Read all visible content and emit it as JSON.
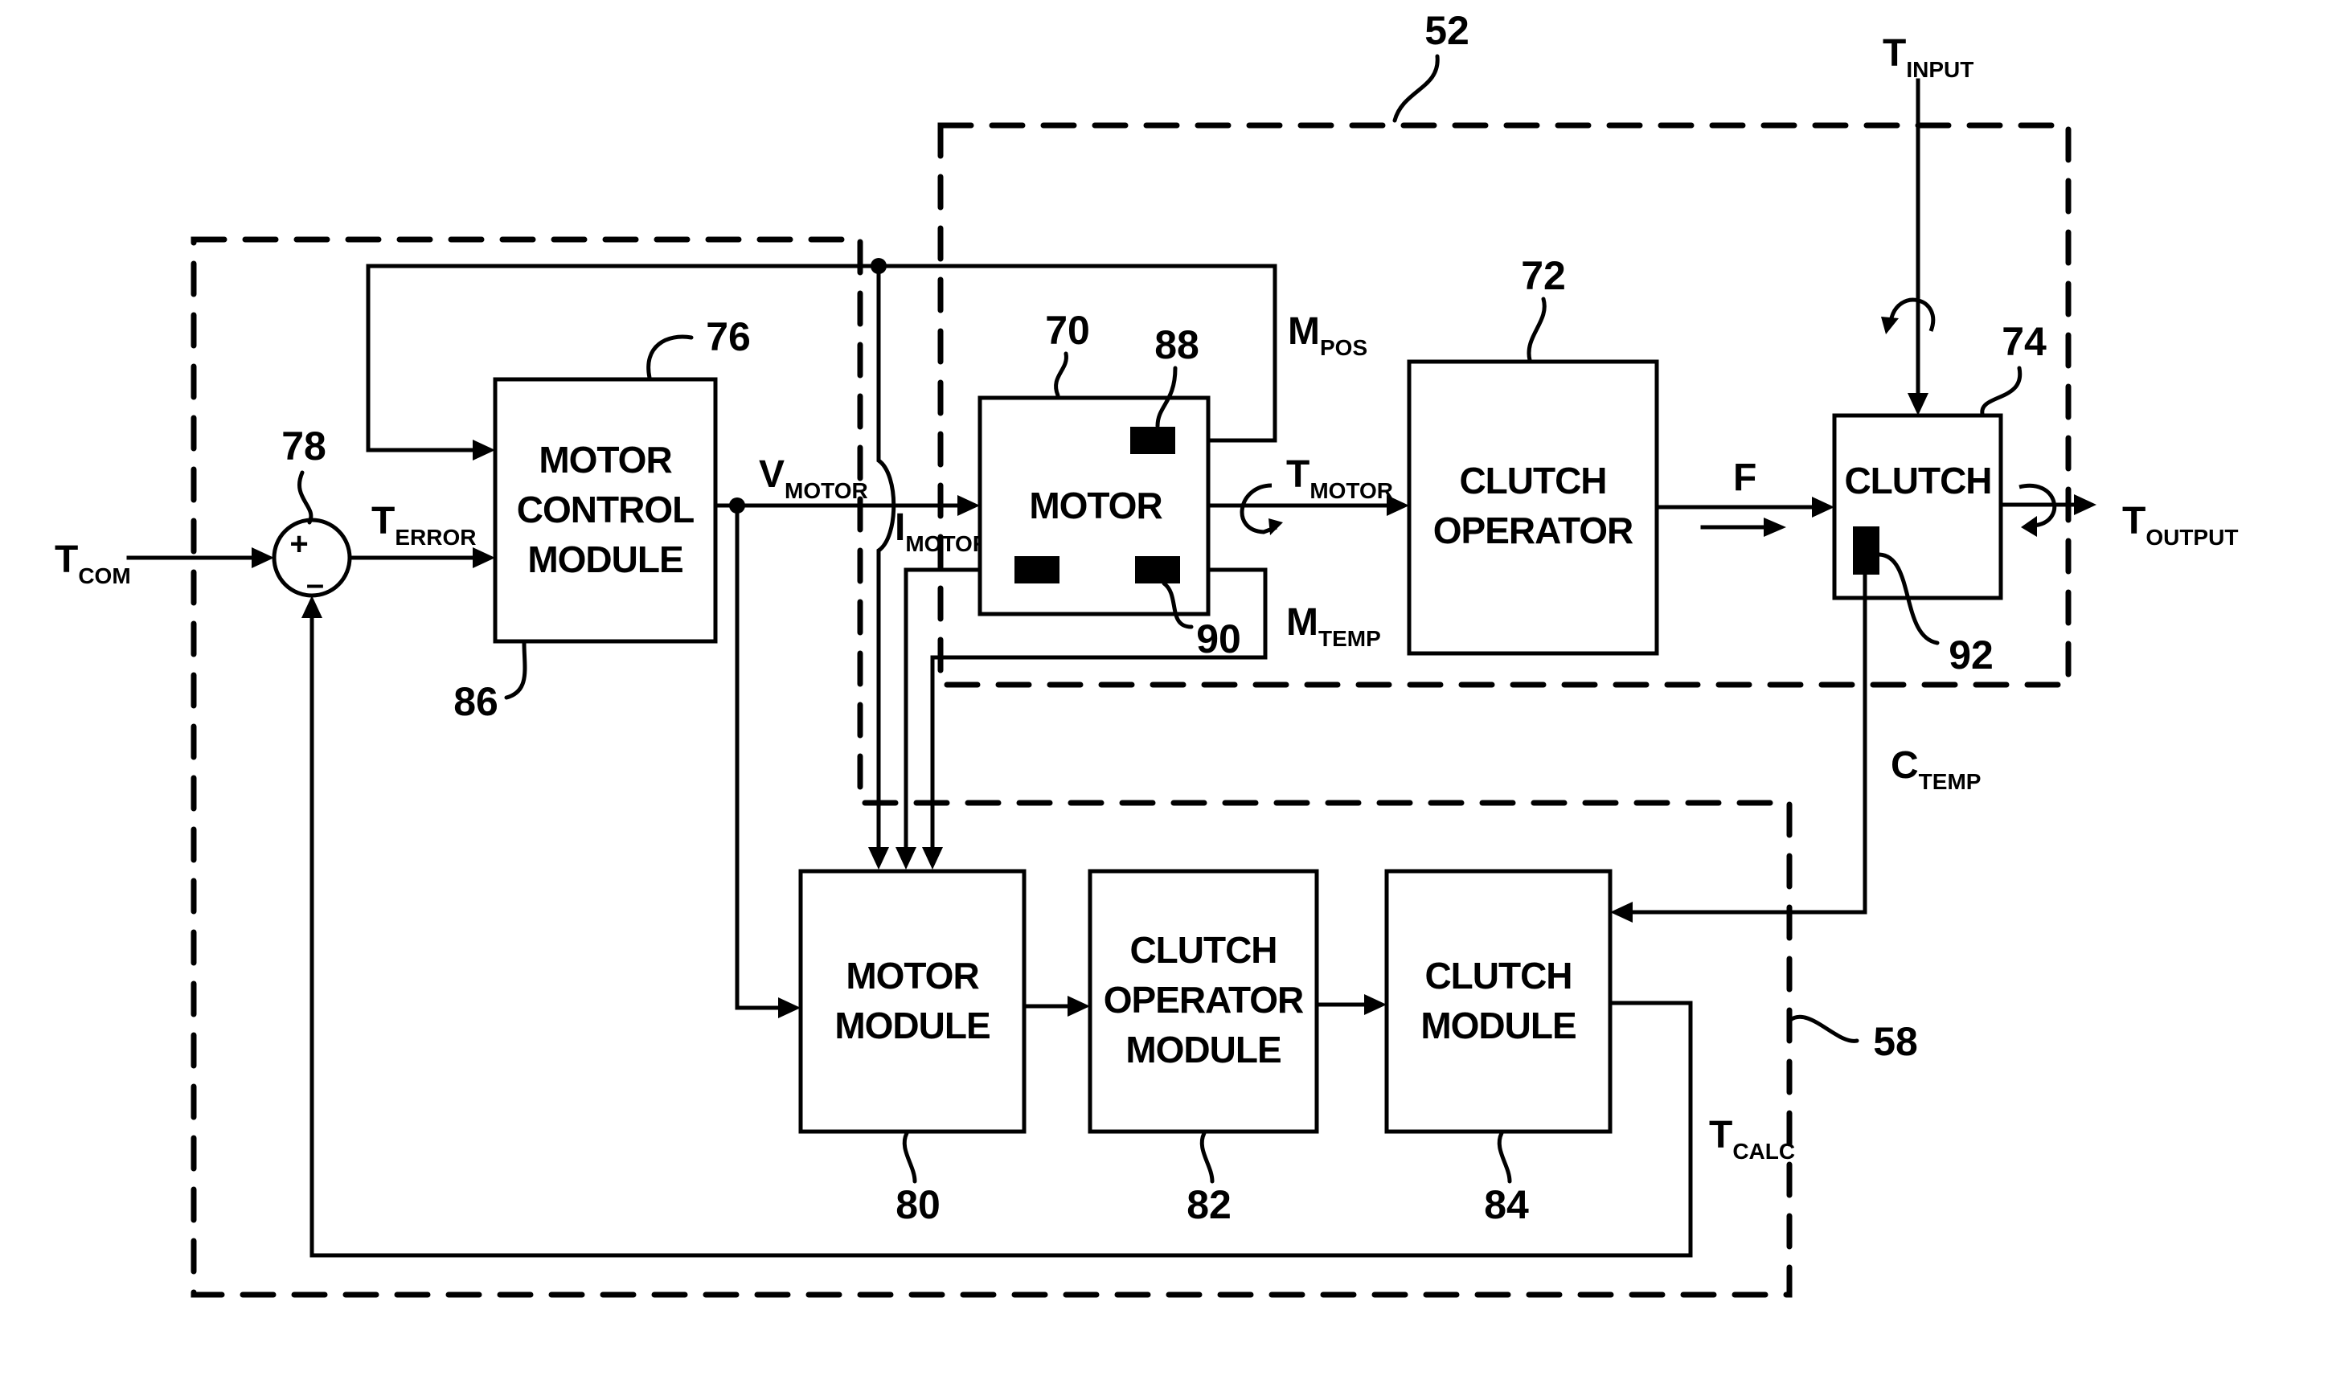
{
  "figure": {
    "description": "Block diagram of motor / clutch torque control system",
    "boundaries": [
      {
        "id": "52",
        "label": "52"
      },
      {
        "id": "58",
        "label": "58"
      }
    ]
  },
  "blocks": {
    "motor_control": {
      "ref": "86",
      "ref_top": "76",
      "lines": [
        "MOTOR",
        "CONTROL",
        "MODULE"
      ]
    },
    "motor": {
      "ref": "70",
      "lines": [
        "MOTOR"
      ]
    },
    "clutch_operator": {
      "ref": "72",
      "lines": [
        "CLUTCH",
        "OPERATOR"
      ]
    },
    "clutch": {
      "ref": "74",
      "lines": [
        "CLUTCH"
      ]
    },
    "motor_module": {
      "ref": "80",
      "lines": [
        "MOTOR",
        "MODULE"
      ]
    },
    "clutch_operator_module": {
      "ref": "82",
      "lines": [
        "CLUTCH",
        "OPERATOR",
        "MODULE"
      ]
    },
    "clutch_module": {
      "ref": "84",
      "lines": [
        "CLUTCH",
        "MODULE"
      ]
    }
  },
  "summing_junction": {
    "ref": "78",
    "plus": "+",
    "minus": "–"
  },
  "sensors": {
    "position": {
      "ref": "88"
    },
    "motor_temp": {
      "ref": "90"
    },
    "clutch_temp": {
      "ref": "92"
    }
  },
  "signals": {
    "t_com": {
      "main": "T",
      "sub": "COM"
    },
    "t_error": {
      "main": "T",
      "sub": "ERROR"
    },
    "v_motor": {
      "main": "V",
      "sub": "MOTOR"
    },
    "i_motor": {
      "main": "I",
      "sub": "MOTOR"
    },
    "m_pos": {
      "main": "M",
      "sub": "POS"
    },
    "m_temp": {
      "main": "M",
      "sub": "TEMP"
    },
    "t_motor": {
      "main": "T",
      "sub": "MOTOR"
    },
    "f": {
      "main": "F",
      "sub": ""
    },
    "t_input": {
      "main": "T",
      "sub": "INPUT"
    },
    "t_output": {
      "main": "T",
      "sub": "OUTPUT"
    },
    "c_temp": {
      "main": "C",
      "sub": "TEMP"
    },
    "t_calc": {
      "main": "T",
      "sub": "CALC"
    }
  }
}
